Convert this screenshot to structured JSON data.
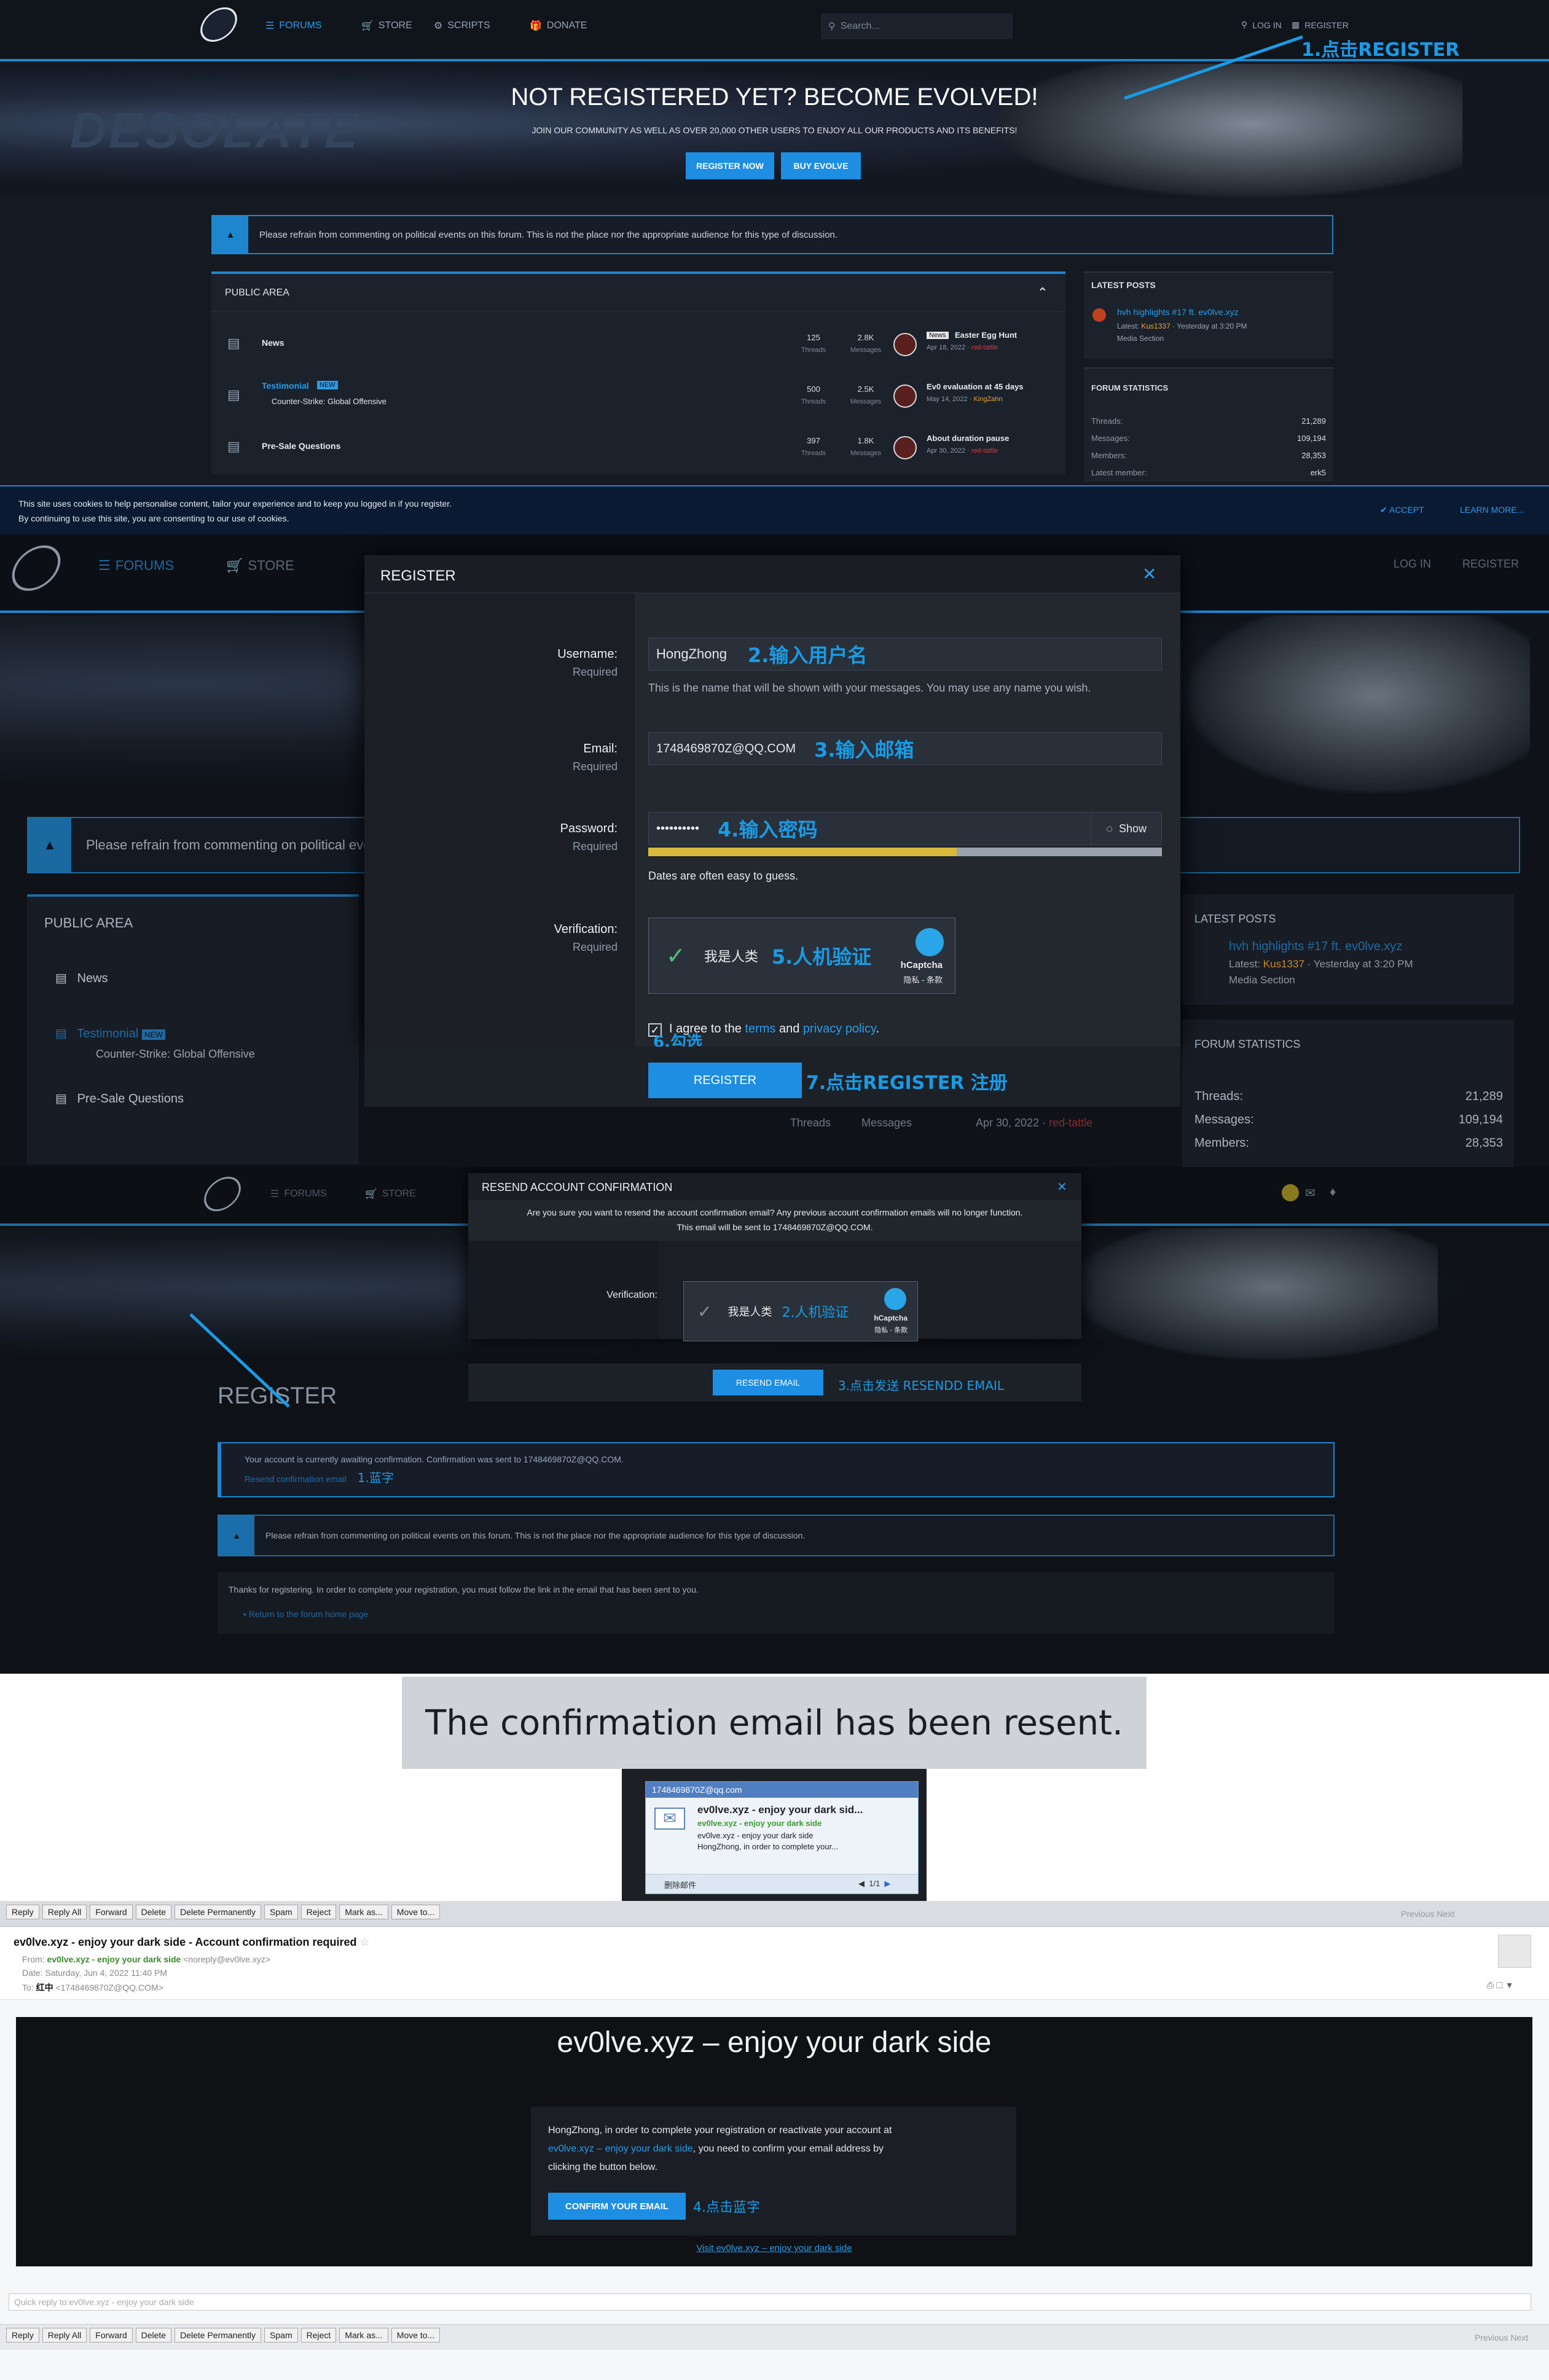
{
  "forum": {
    "nav": {
      "forums": "FORUMS",
      "store": "STORE",
      "scripts": "SCRIPTS",
      "donate": "DONATE",
      "search": "Search...",
      "login": "LOG IN",
      "register": "REGISTER"
    },
    "hero": {
      "title": "NOT REGISTERED YET? BECOME EVOLVED!",
      "subtitle": "JOIN OUR COMMUNITY AS WELL AS OVER 20,000 OTHER USERS TO ENJOY ALL OUR PRODUCTS AND ITS BENEFITS!",
      "register_now": "REGISTER NOW",
      "buy_evolve": "BUY EVOLVE",
      "logo": "DESOLATE"
    },
    "notice": "Please refrain from commenting on political events on this forum. This is not the place nor the appropriate audience for this type of discussion.",
    "public_area": "PUBLIC AREA",
    "nodes": [
      {
        "title": "News",
        "badge": "",
        "sub": "",
        "threads": "125",
        "messages": "2.8K",
        "last_title": "Easter Egg Hunt",
        "last_prefix": "News",
        "last_date": "Apr 18, 2022",
        "last_user": "red-tattle"
      },
      {
        "title": "Testimonial",
        "badge": "NEW",
        "sub": "Counter-Strike: Global Offensive",
        "threads": "500",
        "messages": "2.5K",
        "last_title": "Ev0 evaluation at 45 days",
        "last_prefix": "",
        "last_date": "May 14, 2022",
        "last_user": "KingZahn"
      },
      {
        "title": "Pre-Sale Questions",
        "badge": "",
        "sub": "",
        "threads": "397",
        "messages": "1.8K",
        "last_title": "About duration pause",
        "last_prefix": "",
        "last_date": "Apr 30, 2022",
        "last_user": "red-tattle"
      }
    ],
    "threads_label": "Threads",
    "messages_label": "Messages",
    "latest_posts": {
      "heading": "LATEST POSTS",
      "title": "hvh highlights #17 ft. ev0lve.xyz",
      "latest": "Latest:",
      "user": "Kus1337",
      "time": "Yesterday at 3:20 PM",
      "section": "Media Section"
    },
    "stats": {
      "heading": "FORUM STATISTICS",
      "threads_label": "Threads:",
      "threads": "21,289",
      "messages_label": "Messages:",
      "messages": "109,194",
      "members_label": "Members:",
      "members": "28,353",
      "latest_label": "Latest member:",
      "latest": "erk5"
    },
    "cookie": {
      "text1": "This site uses cookies to help personalise content, tailor your experience and to keep you logged in if you register.",
      "text2": "By continuing to use this site, you are consenting to our use of cookies.",
      "accept": "ACCEPT",
      "learn": "LEARN MORE..."
    }
  },
  "steps": {
    "s1_register": "1.点击REGISTER",
    "s2": "2.输入用户名",
    "s3": "3.输入邮箱",
    "s4": "4.输入密码",
    "s5": "5.人机验证",
    "s6": "6.勾选",
    "s7": "7.点击REGISTER 注册",
    "r1": "1.蓝字",
    "r2": "2.人机验证",
    "r3": "3.点击发送 RESENDD EMAIL",
    "e4": "4.点击蓝字"
  },
  "register_modal": {
    "title": "REGISTER",
    "username_label": "Username:",
    "required": "Required",
    "username": "HongZhong",
    "username_hint": "This is the name that will be shown with your messages. You may use any name you wish.",
    "email_label": "Email:",
    "email": "1748469870Z@QQ.COM",
    "password_label": "Password:",
    "password": "••••••••••",
    "show": "Show",
    "password_hint": "Dates are often easy to guess.",
    "verification_label": "Verification:",
    "human": "我是人类",
    "hcaptcha": "hCaptcha",
    "hcaptcha_sub": "隐私 - 条款",
    "agree_pre": "I agree to the ",
    "terms": "terms",
    "agree_mid": " and ",
    "privacy": "privacy policy",
    "agree_end": ".",
    "submit": "REGISTER"
  },
  "resend_modal": {
    "title": "RESEND ACCOUNT CONFIRMATION",
    "text1": "Are you sure you want to resend the account confirmation email? Any previous account confirmation emails will no longer function.",
    "text2": "This email will be sent to 1748469870Z@QQ.COM.",
    "verification_label": "Verification:",
    "submit": "RESEND EMAIL"
  },
  "register_page": {
    "title": "REGISTER",
    "awaiting": "Your account is currently awaiting confirmation. Confirmation was sent to 1748469870Z@QQ.COM.",
    "resend_link": "Resend confirmation email",
    "thanks": "Thanks for registering. In order to complete your registration, you must follow the link in the email that has been sent to you.",
    "return_link": "Return to the forum home page"
  },
  "toast": "The confirmation email has been resent.",
  "notification": {
    "address": "1748469870Z@qq.com",
    "subject": "ev0lve.xyz - enjoy your dark sid...",
    "from": "ev0lve.xyz - enjoy your dark side",
    "line1": "ev0lve.xyz - enjoy your dark side",
    "line2": "HongZhong, in order to complete your...",
    "delete": "删除邮件",
    "pager": "1/1"
  },
  "email": {
    "toolbar": [
      "Reply",
      "Reply All",
      "Forward",
      "Delete",
      "Delete Permanently",
      "Spam",
      "Reject",
      "Mark as...",
      "Move to..."
    ],
    "pager": "Previous Next",
    "subject": "ev0lve.xyz - enjoy your dark side - Account confirmation required",
    "from_label": "From:",
    "from_name": "ev0lve.xyz - enjoy your dark side",
    "from_addr": "<noreply@ev0lve.xyz>",
    "date_label": "Date:",
    "date": "Saturday, Jun 4, 2022 11:40 PM",
    "to_label": "To:",
    "to_name": "红中",
    "to_addr": "<1748469870Z@QQ.COM>",
    "heading": "ev0lve.xyz – enjoy your dark side",
    "body1": "HongZhong, in order to complete your registration or reactivate your account at",
    "body_link": "ev0lve.xyz – enjoy your dark side",
    "body2": ", you need to confirm your email address by",
    "body3": "clicking the button below.",
    "confirm": "CONFIRM YOUR EMAIL",
    "visit": "Visit ev0lve.xyz – enjoy your dark side",
    "quick_reply": "Quick reply to:ev0lve.xyz - enjoy your dark side"
  }
}
